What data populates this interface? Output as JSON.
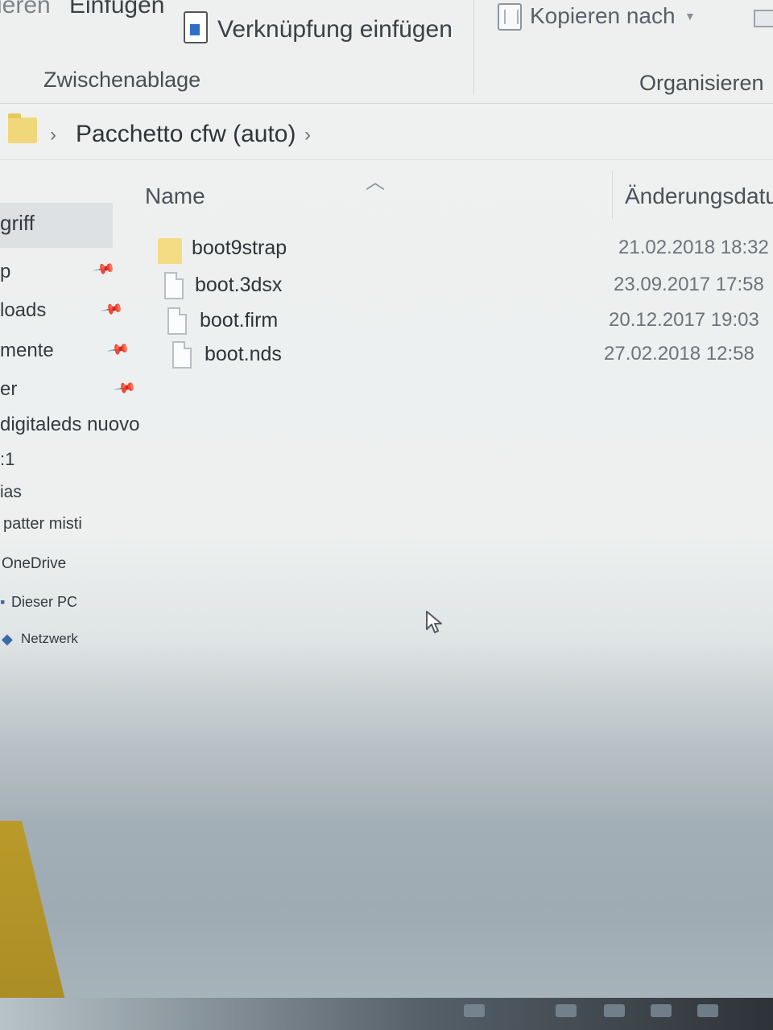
{
  "ribbon": {
    "paste_partial": "ieren",
    "insert_label": "Einfügen",
    "paste_shortcut_label": "Verknüpfung einfügen",
    "copy_to_label": "Kopieren nach",
    "clipboard_group": "Zwischenablage",
    "organize_group": "Organisieren"
  },
  "address": {
    "path": "Pacchetto cfw (auto)"
  },
  "columns": {
    "name": "Name",
    "modified": "Änderungsdatu"
  },
  "nav": {
    "items": [
      {
        "label": "griff",
        "pinned": false
      },
      {
        "label": "p",
        "pinned": true
      },
      {
        "label": "loads",
        "pinned": true
      },
      {
        "label": "mente",
        "pinned": true
      },
      {
        "label": "er",
        "pinned": true
      },
      {
        "label": "digitaleds nuovo",
        "pinned": false
      },
      {
        "label": ":1",
        "pinned": false
      },
      {
        "label": "ias",
        "pinned": false
      },
      {
        "label": "patter misti",
        "pinned": false
      },
      {
        "label": "OneDrive",
        "pinned": false
      },
      {
        "label": "Dieser PC",
        "pinned": false
      },
      {
        "label": "Netzwerk",
        "pinned": false
      }
    ]
  },
  "files": [
    {
      "name": "boot9strap",
      "type": "folder",
      "date": "21.02.2018 18:32"
    },
    {
      "name": "boot.3dsx",
      "type": "file",
      "date": "23.09.2017 17:58"
    },
    {
      "name": "boot.firm",
      "type": "file",
      "date": "20.12.2017 19:03"
    },
    {
      "name": "boot.nds",
      "type": "file",
      "date": "27.02.2018 12:58"
    }
  ],
  "colors": {
    "folder": "#f0d77a",
    "selection": "#dde1e3",
    "shortcut_arrow": "#2f6fc3"
  }
}
